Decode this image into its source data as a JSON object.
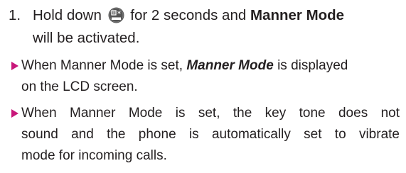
{
  "step1": {
    "number": "1.",
    "text_before": "Hold down",
    "text_after": "for 2 seconds and",
    "bold_term": "Manner Mode",
    "line2": "will be activated.",
    "key_icon": "shift-star-key-icon"
  },
  "bullets": [
    {
      "line1_before": "When Manner Mode is set,",
      "line1_emph": "Manner Mode",
      "line1_after": "is displayed",
      "line2": "on the LCD screen."
    },
    {
      "line1": "When Manner Mode is set, the key tone does not",
      "line2": "sound and the phone is automatically set to vibrate",
      "line3": "mode for incoming calls."
    }
  ],
  "colors": {
    "bullet_arrow": "#c8177a",
    "text": "#231f20",
    "key_icon": "#555555"
  }
}
